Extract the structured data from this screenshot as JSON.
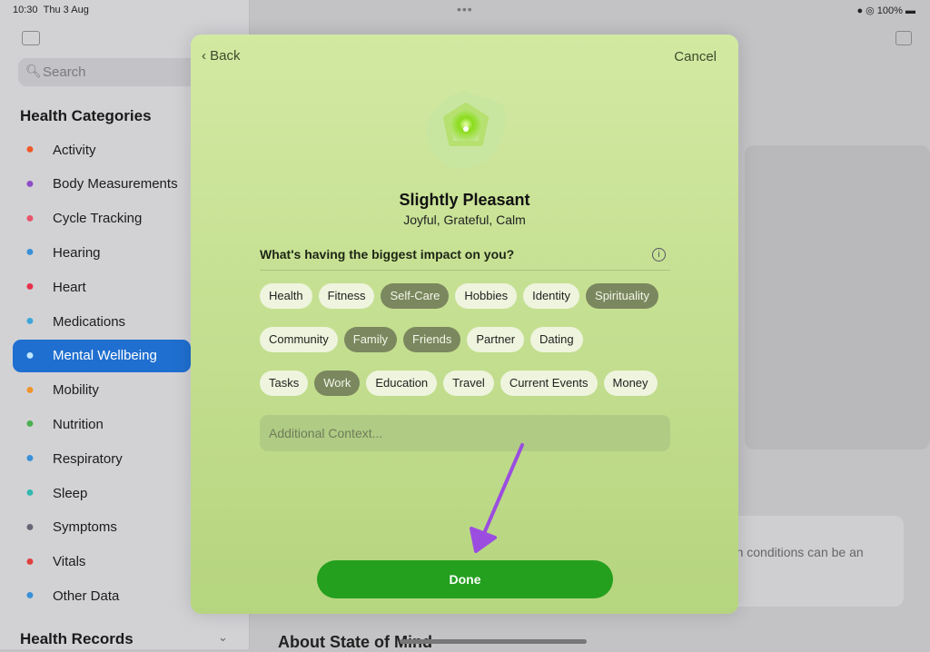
{
  "status": {
    "time": "10:30",
    "date": "Thu 3 Aug",
    "battery": "100%"
  },
  "sidebar": {
    "search_placeholder": "Search",
    "section_title": "Health Categories",
    "items": [
      {
        "label": "Activity",
        "icon": "flame-icon",
        "color": "#f05a28"
      },
      {
        "label": "Body Measurements",
        "icon": "figure-icon",
        "color": "#8e4ec6"
      },
      {
        "label": "Cycle Tracking",
        "icon": "cycle-icon",
        "color": "#e8546b"
      },
      {
        "label": "Hearing",
        "icon": "ear-icon",
        "color": "#3a8fd8"
      },
      {
        "label": "Heart",
        "icon": "heart-icon",
        "color": "#e8304a"
      },
      {
        "label": "Medications",
        "icon": "pills-icon",
        "color": "#3fa6d8"
      },
      {
        "label": "Mental Wellbeing",
        "icon": "head-icon",
        "color": "#5ac8fa",
        "selected": true
      },
      {
        "label": "Mobility",
        "icon": "arrows-icon",
        "color": "#f0932b"
      },
      {
        "label": "Nutrition",
        "icon": "apple-icon",
        "color": "#4cb050"
      },
      {
        "label": "Respiratory",
        "icon": "lungs-icon",
        "color": "#3a8fd8"
      },
      {
        "label": "Sleep",
        "icon": "bed-icon",
        "color": "#34b8b0"
      },
      {
        "label": "Symptoms",
        "icon": "clipboard-icon",
        "color": "#667"
      },
      {
        "label": "Vitals",
        "icon": "waveform-icon",
        "color": "#e04040"
      },
      {
        "label": "Other Data",
        "icon": "plus-icon",
        "color": "#3a8fd8"
      }
    ],
    "section2_title": "Health Records"
  },
  "main": {
    "card_text": "non conditions can be an",
    "about_title": "About State of Mind"
  },
  "modal": {
    "back_label": "Back",
    "cancel_label": "Cancel",
    "mood": "Slightly Pleasant",
    "feelings": "Joyful, Grateful, Calm",
    "question": "What's having the biggest impact on you?",
    "rows": [
      [
        {
          "label": "Health"
        },
        {
          "label": "Fitness"
        },
        {
          "label": "Self-Care",
          "selected": true
        },
        {
          "label": "Hobbies"
        },
        {
          "label": "Identity"
        },
        {
          "label": "Spirituality",
          "selected": true
        }
      ],
      [
        {
          "label": "Community"
        },
        {
          "label": "Family",
          "selected": true
        },
        {
          "label": "Friends",
          "selected": true
        },
        {
          "label": "Partner"
        },
        {
          "label": "Dating"
        }
      ],
      [
        {
          "label": "Tasks"
        },
        {
          "label": "Work",
          "selected": true
        },
        {
          "label": "Education"
        },
        {
          "label": "Travel"
        },
        {
          "label": "Current Events"
        },
        {
          "label": "Money"
        }
      ]
    ],
    "context_placeholder": "Additional Context...",
    "done_label": "Done",
    "accent": "#24a01e"
  }
}
